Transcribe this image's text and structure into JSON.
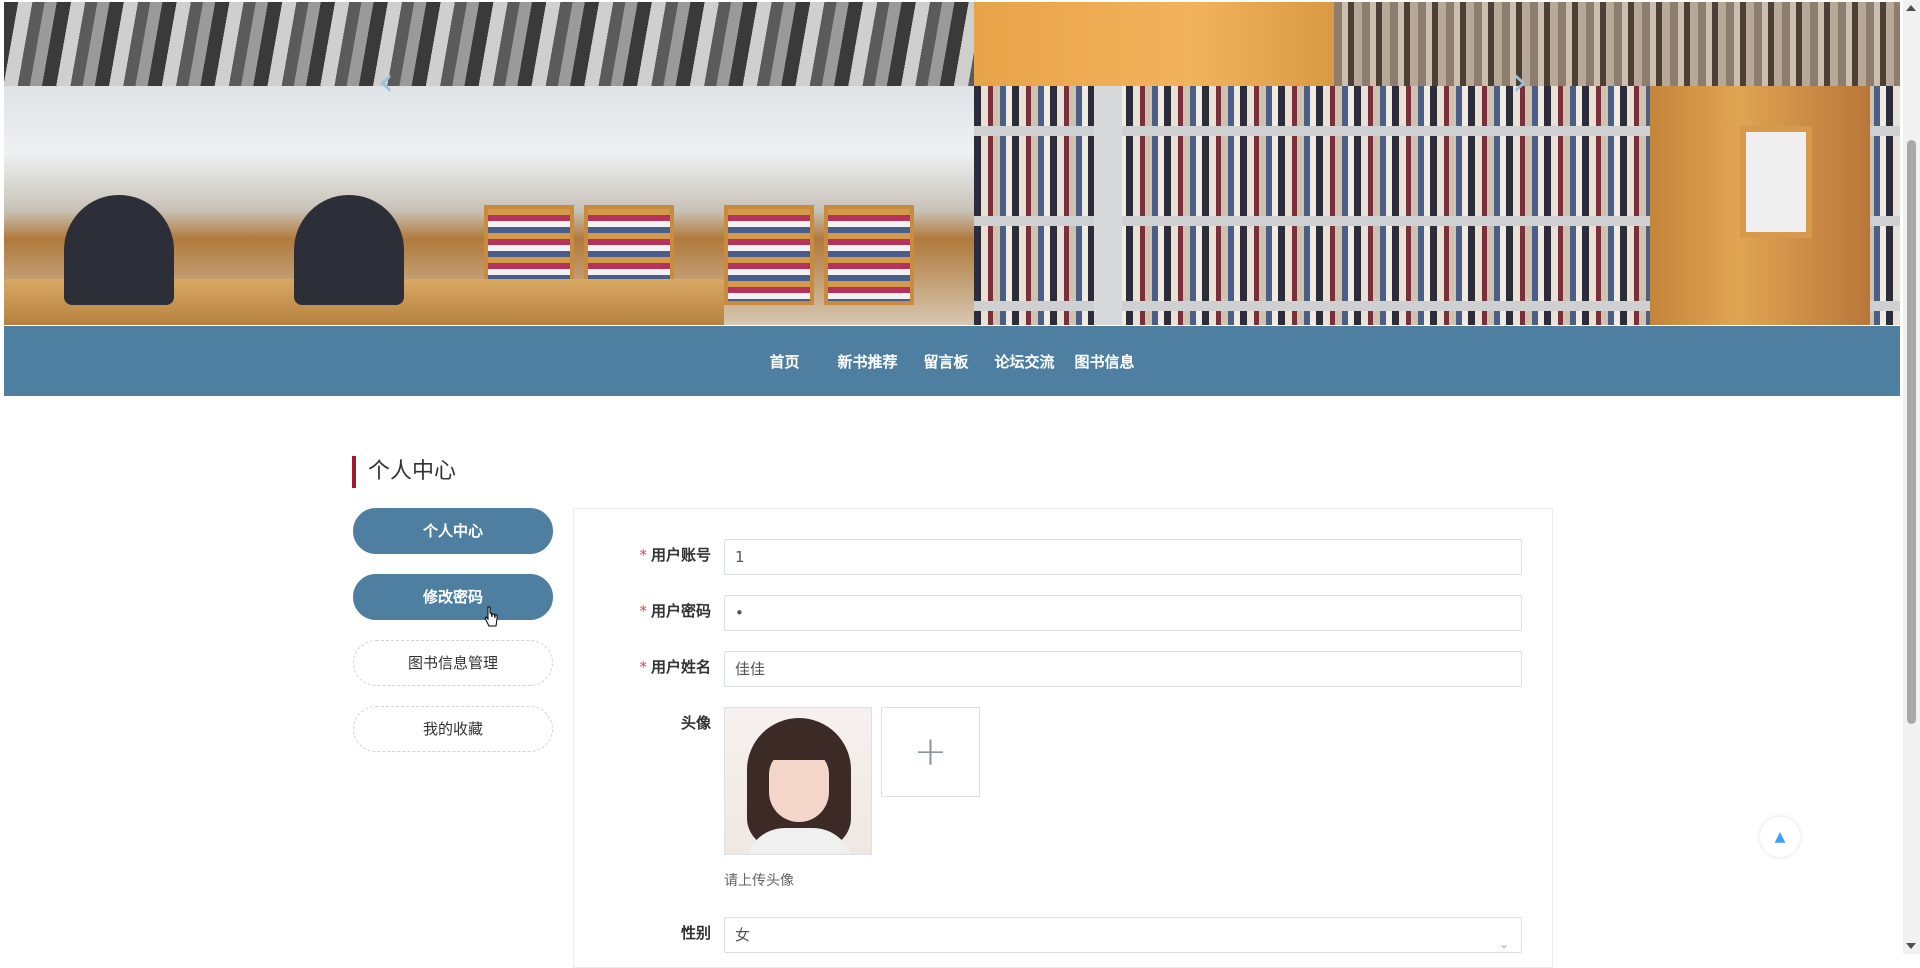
{
  "nav": {
    "items": [
      "首页",
      "新书推荐",
      "留言板",
      "论坛交流",
      "图书信息"
    ]
  },
  "carousel": {
    "prev_glyph": "‹",
    "next_glyph": "›"
  },
  "page": {
    "section_title": "个人中心"
  },
  "sidebar": {
    "items": [
      {
        "label": "个人中心",
        "active": true
      },
      {
        "label": "修改密码",
        "active": true
      },
      {
        "label": "图书信息管理",
        "active": false
      },
      {
        "label": "我的收藏",
        "active": false
      }
    ]
  },
  "form": {
    "account": {
      "label": "用户账号",
      "required_mark": "*",
      "value": "1"
    },
    "password": {
      "label": "用户密码",
      "required_mark": "*",
      "value": "•"
    },
    "name": {
      "label": "用户姓名",
      "required_mark": "*",
      "value": "佳佳"
    },
    "avatar": {
      "label": "头像",
      "upload_glyph": "+",
      "hint": "请上传头像"
    },
    "gender": {
      "label": "性别",
      "value": "女",
      "arrow_glyph": "⌄"
    }
  },
  "back_to_top": {
    "glyph": "▲"
  },
  "colors": {
    "primary": "#4e7fa1",
    "accent_bar": "#a0192b",
    "required": "#e04848"
  },
  "icons": {
    "prev": "chevron-left-icon",
    "next": "chevron-right-icon",
    "upload": "plus-icon",
    "select": "chevron-down-icon",
    "back_top": "arrow-up-icon"
  }
}
